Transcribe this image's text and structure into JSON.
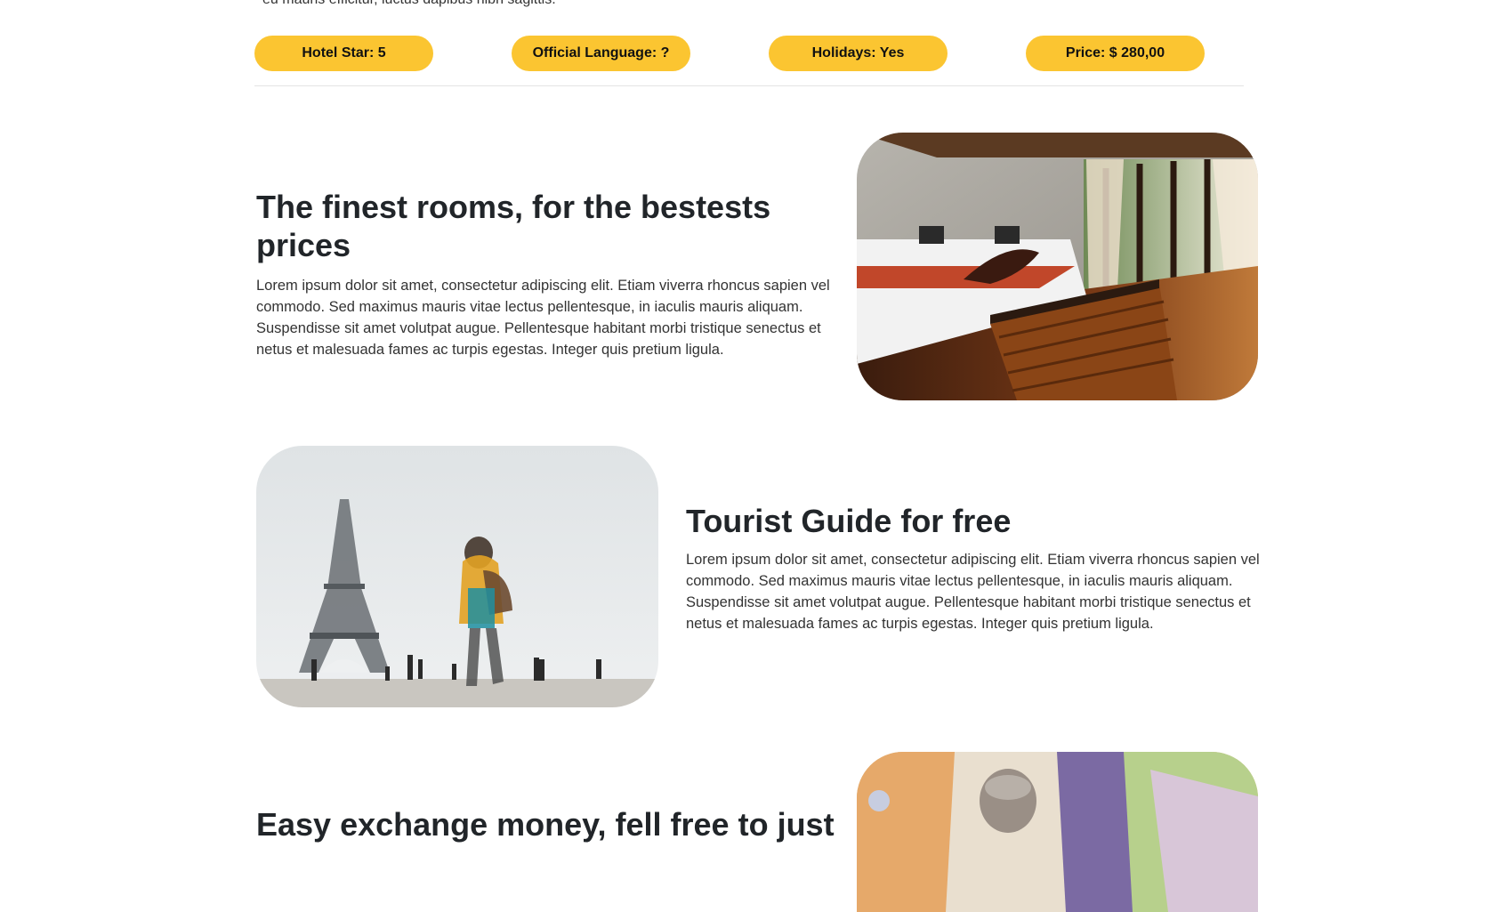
{
  "intro": {
    "tail_text": "eu mauris efficitur, luctus dapibus nibh sagittis."
  },
  "pills": [
    {
      "label": "Hotel Star: 5"
    },
    {
      "label": "Official Language: ?"
    },
    {
      "label": "Holidays: Yes"
    },
    {
      "label": "Price: $ 280,00"
    }
  ],
  "colors": {
    "accent": "#fbc531",
    "heading": "#212529",
    "text": "#333333"
  },
  "features": [
    {
      "title": "The finest rooms, for the bestests prices",
      "text": "Lorem ipsum dolor sit amet, consectetur adipiscing elit. Etiam viverra rhoncus sapien vel commodo. Sed maximus mauris vitae lectus pellentesque, in iaculis mauris aliquam. Suspendisse sit amet volutpat augue. Pellentesque habitant morbi tristique senectus et netus et malesuada fames ac turpis egestas. Integer quis pretium ligula."
    },
    {
      "title": "Tourist Guide for free",
      "text": "Lorem ipsum dolor sit amet, consectetur adipiscing elit. Etiam viverra rhoncus sapien vel commodo. Sed maximus mauris vitae lectus pellentesque, in iaculis mauris aliquam. Suspendisse sit amet volutpat augue. Pellentesque habitant morbi tristique senectus et netus et malesuada fames ac turpis egestas. Integer quis pretium ligula."
    },
    {
      "title": "Easy exchange money, fell free to just"
    }
  ]
}
